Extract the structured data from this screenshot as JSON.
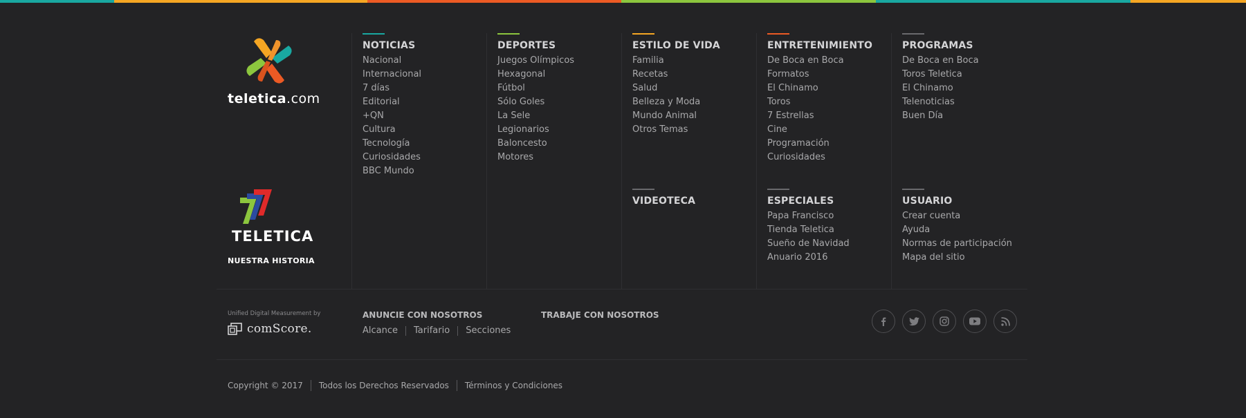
{
  "top_bar_colors": [
    "#19a8a1",
    "#f5a623",
    "#ec5a24",
    "#8cc63e",
    "#19a8a1",
    "#f5a623"
  ],
  "brand": {
    "logo_name": "teletica-x-logo",
    "site_text": "teletica",
    "site_suffix": ".com",
    "channel_text": "TELETICA",
    "history_label": "NUESTRA HISTORIA"
  },
  "menu": {
    "noticias": {
      "accent": "#19a8a1",
      "title": "NOTICIAS",
      "items": [
        "Nacional",
        "Internacional",
        "7 días",
        "Editorial",
        "+QN",
        "Cultura",
        "Tecnología",
        "Curiosidades",
        "BBC Mundo"
      ]
    },
    "deportes": {
      "accent": "#8cc63e",
      "title": "DEPORTES",
      "items": [
        "Juegos Olímpicos",
        "Hexagonal",
        "Fútbol",
        "Sólo Goles",
        "La Sele",
        "Legionarios",
        "Baloncesto",
        "Motores"
      ]
    },
    "estilo": {
      "accent": "#f5a623",
      "title": "ESTILO DE VIDA",
      "items": [
        "Familia",
        "Recetas",
        "Salud",
        "Belleza y Moda",
        "Mundo Animal",
        "Otros Temas"
      ]
    },
    "entretenimiento": {
      "accent": "#ec5a24",
      "title": "ENTRETENIMIENTO",
      "items": [
        "De Boca en Boca",
        "Formatos",
        "El Chinamo",
        "Toros",
        "7 Estrellas",
        "Cine",
        "Programación",
        "Curiosidades"
      ]
    },
    "programas": {
      "accent": "#6a6a6d",
      "title": "PROGRAMAS",
      "items": [
        "De Boca en Boca",
        "Toros Teletica",
        "El Chinamo",
        "Telenoticias",
        "Buen Día"
      ]
    },
    "videoteca": {
      "accent": "#6a6a6d",
      "title": "VIDEOTECA",
      "items": []
    },
    "especiales": {
      "accent": "#6a6a6d",
      "title": "ESPECIALES",
      "items": [
        "Papa Francisco",
        "Tienda Teletica",
        "Sueño de Navidad",
        "Anuario 2016"
      ]
    },
    "usuario": {
      "accent": "#6a6a6d",
      "title": "USUARIO",
      "items": [
        "Crear cuenta",
        "Ayuda",
        "Normas de participación",
        "Mapa del sitio"
      ]
    }
  },
  "comscore": {
    "label": "Unified Digital Measurement by",
    "name": "comScore."
  },
  "anuncie": {
    "title": "ANUNCIE CON NOSOTROS",
    "links": [
      "Alcance",
      "Tarifario",
      "Secciones"
    ]
  },
  "trabaje": "TRABAJE CON NOSOTROS",
  "social": [
    "facebook-icon",
    "twitter-icon",
    "instagram-icon",
    "youtube-icon",
    "rss-icon"
  ],
  "footer": {
    "copyright": "Copyright © 2017",
    "rights": "Todos los Derechos Reservados",
    "terms": "Términos y Condiciones"
  }
}
